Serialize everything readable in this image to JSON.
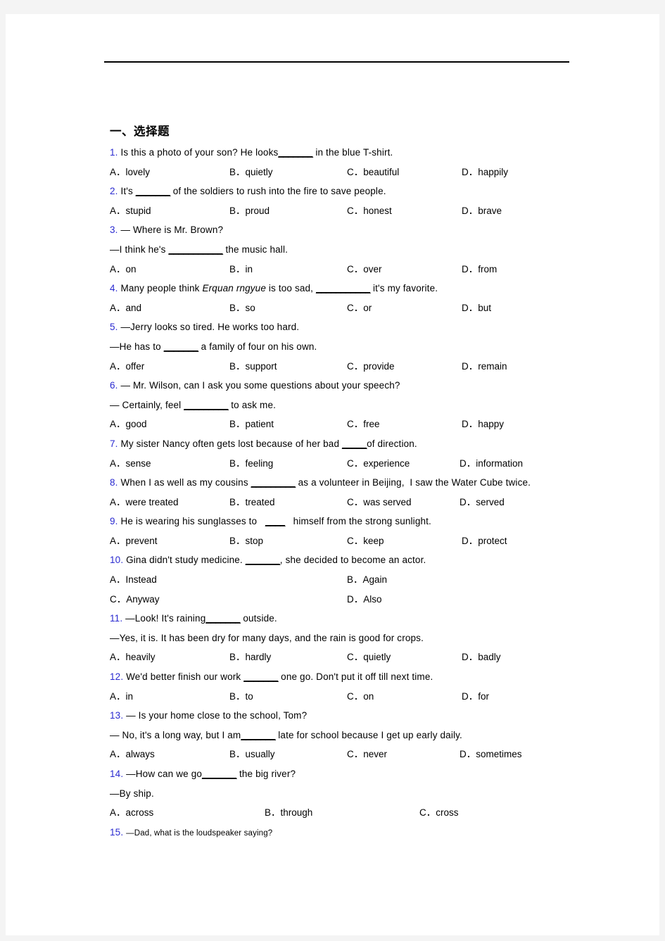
{
  "page": {
    "section_title": "一、选择题",
    "number_color": "#2a2ad0"
  },
  "questions": [
    {
      "num": "1.",
      "lines": [
        "Is this a photo of your son? He looks_______ in the blue T-shirt."
      ],
      "options": [
        "A．lovely",
        "B．quietly",
        "C．beautiful",
        "D．happily"
      ]
    },
    {
      "num": "2.",
      "lines": [
        "It's _______ of the soldiers to rush into the fire to save people."
      ],
      "options": [
        "A．stupid",
        "B．proud",
        "C．honest",
        "D．brave"
      ]
    },
    {
      "num": "3.",
      "lines": [
        "— Where is Mr. Brown?",
        "—I think he's ___________ the music hall."
      ],
      "options": [
        "A．on",
        "B．in",
        "C．over",
        "D．from"
      ]
    },
    {
      "num": "4.",
      "lines": [
        "Many people think Erquan rngyue is too sad, ___________ it's my favorite."
      ],
      "options": [
        "A．and",
        "B．so",
        "C．or",
        "D．but"
      ]
    },
    {
      "num": "5.",
      "lines": [
        "—Jerry looks so tired. He works too hard.",
        "—He has to _______ a family of four on his own."
      ],
      "options": [
        "A．offer",
        "B．support",
        "C．provide",
        "D．remain"
      ]
    },
    {
      "num": "6.",
      "lines": [
        "— Mr. Wilson, can I ask you some questions about your speech?",
        "— Certainly, feel _________ to ask me."
      ],
      "options": [
        "A．good",
        "B．patient",
        "C．free",
        "D．happy"
      ]
    },
    {
      "num": "7.",
      "lines": [
        "My sister Nancy often gets lost because of her bad _____of direction."
      ],
      "options": [
        "A．sense",
        "B．feeling",
        "C．experience",
        "D．information"
      ]
    },
    {
      "num": "8.",
      "lines": [
        "When I as well as my cousins _________ as a volunteer in Beijing,  I saw the Water Cube twice."
      ],
      "options": [
        "A．were treated",
        "B．treated",
        "C．was served",
        "D．served"
      ]
    },
    {
      "num": "9.",
      "lines": [
        "He is wearing his sunglasses to   ____   himself from the strong sunlight."
      ],
      "options": [
        "A．prevent",
        "B．stop",
        "C．keep",
        "D．protect"
      ]
    },
    {
      "num": "10.",
      "lines": [
        "Gina didn't study medicine. _______, she decided to become an actor."
      ],
      "options": [
        "A．Instead",
        "B．Again",
        "C．Anyway",
        "D．Also"
      ]
    },
    {
      "num": "11.",
      "lines": [
        "—Look! It's raining_______ outside.",
        "—Yes, it is. It has been dry for many days, and the rain is good for crops."
      ],
      "options": [
        "A．heavily",
        "B．hardly",
        "C．quietly",
        "D．badly"
      ]
    },
    {
      "num": "12.",
      "lines": [
        "We'd better finish our work _______ one go. Don't put it off till next time."
      ],
      "options": [
        "A．in",
        "B．to",
        "C．on",
        "D．for"
      ]
    },
    {
      "num": "13.",
      "lines": [
        "— Is your home close to the school, Tom?",
        "— No, it's a long way, but I am_______ late for school because I get up early daily."
      ],
      "options": [
        "A．always",
        "B．usually",
        "C．never",
        "D．sometimes"
      ]
    },
    {
      "num": "14.",
      "lines": [
        "—How can we go_______ the big river?",
        "—By ship."
      ],
      "options": [
        "A．across",
        "B．through",
        "C．cross"
      ]
    },
    {
      "num": "15.",
      "lines": [
        "—Dad, what is the loudspeaker saying?"
      ],
      "options": []
    }
  ]
}
